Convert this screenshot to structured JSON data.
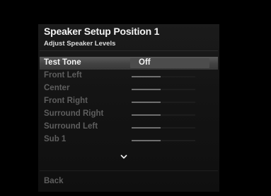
{
  "header": {
    "title": "Speaker Setup Position 1",
    "subtitle": "Adjust Speaker Levels"
  },
  "menu": {
    "items": [
      {
        "label": "Test Tone",
        "value": "Off",
        "selected": true
      },
      {
        "label": "Front Left",
        "level": 0.45
      },
      {
        "label": "Center",
        "level": 0.45
      },
      {
        "label": "Front Right",
        "level": 0.45
      },
      {
        "label": "Surround Right",
        "level": 0.45
      },
      {
        "label": "Surround Left",
        "level": 0.45
      },
      {
        "label": "Sub 1",
        "level": 0.45
      }
    ],
    "more_icon": "chevron-down-icon"
  },
  "footer": {
    "back_label": "Back"
  }
}
